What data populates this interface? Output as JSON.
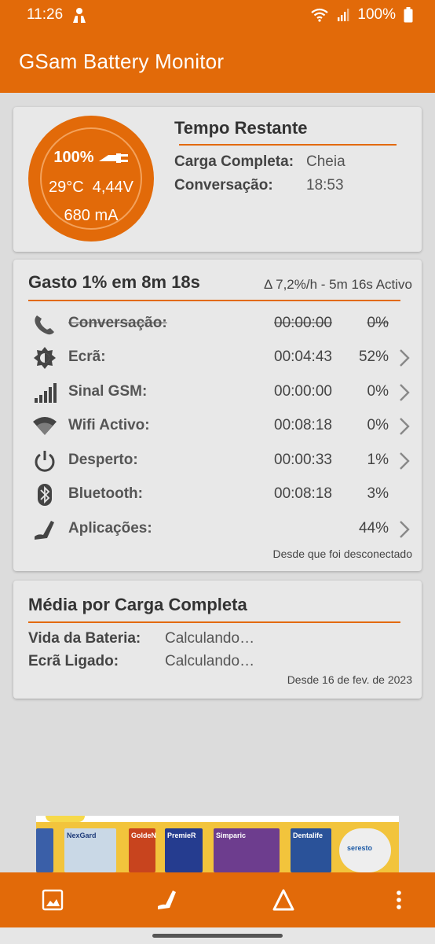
{
  "status_bar": {
    "time": "11:26",
    "battery": "100%"
  },
  "app": {
    "title": "GSam Battery Monitor"
  },
  "gauge": {
    "percent": "100%",
    "temp_voltage": "29°C  4,44V",
    "current": "680 mA"
  },
  "time_left": {
    "title": "Tempo Restante",
    "full_charge_label": "Carga Completa:",
    "full_charge_value": "Cheia",
    "talk_label": "Conversação:",
    "talk_value": "18:53"
  },
  "usage": {
    "title": "Gasto 1% em 8m 18s",
    "subtitle": "Δ 7,2%/h - 5m 16s Activo",
    "rows": [
      {
        "name": "Conversação:",
        "time": "00:00:00",
        "pct": "0%"
      },
      {
        "name": "Ecrã:",
        "time": "00:04:43",
        "pct": "52%"
      },
      {
        "name": "Sinal GSM:",
        "time": "00:00:00",
        "pct": "0%"
      },
      {
        "name": "Wifi Activo:",
        "time": "00:08:18",
        "pct": "0%"
      },
      {
        "name": "Desperto:",
        "time": "00:00:33",
        "pct": "1%"
      },
      {
        "name": "Bluetooth:",
        "time": "00:08:18",
        "pct": "3%"
      },
      {
        "name": "Aplicações:",
        "time": "",
        "pct": "44%"
      }
    ],
    "footnote": "Desde que foi desconectado"
  },
  "average": {
    "title": "Média por Carga Completa",
    "battery_life_label": "Vida da Bateria:",
    "battery_life_value": "Calculando…",
    "screen_on_label": "Ecrã Ligado:",
    "screen_on_value": "Calculando…",
    "footnote": "Desde 16 de fev. de 2023"
  },
  "ad": {
    "products": [
      "NexGard",
      "GoldeN",
      "PremieR",
      "Simparic",
      "Dentalife",
      "seresto"
    ]
  },
  "colors": {
    "accent": "#e26a09",
    "background": "#dcdcdc",
    "card": "#e8e8e8"
  }
}
